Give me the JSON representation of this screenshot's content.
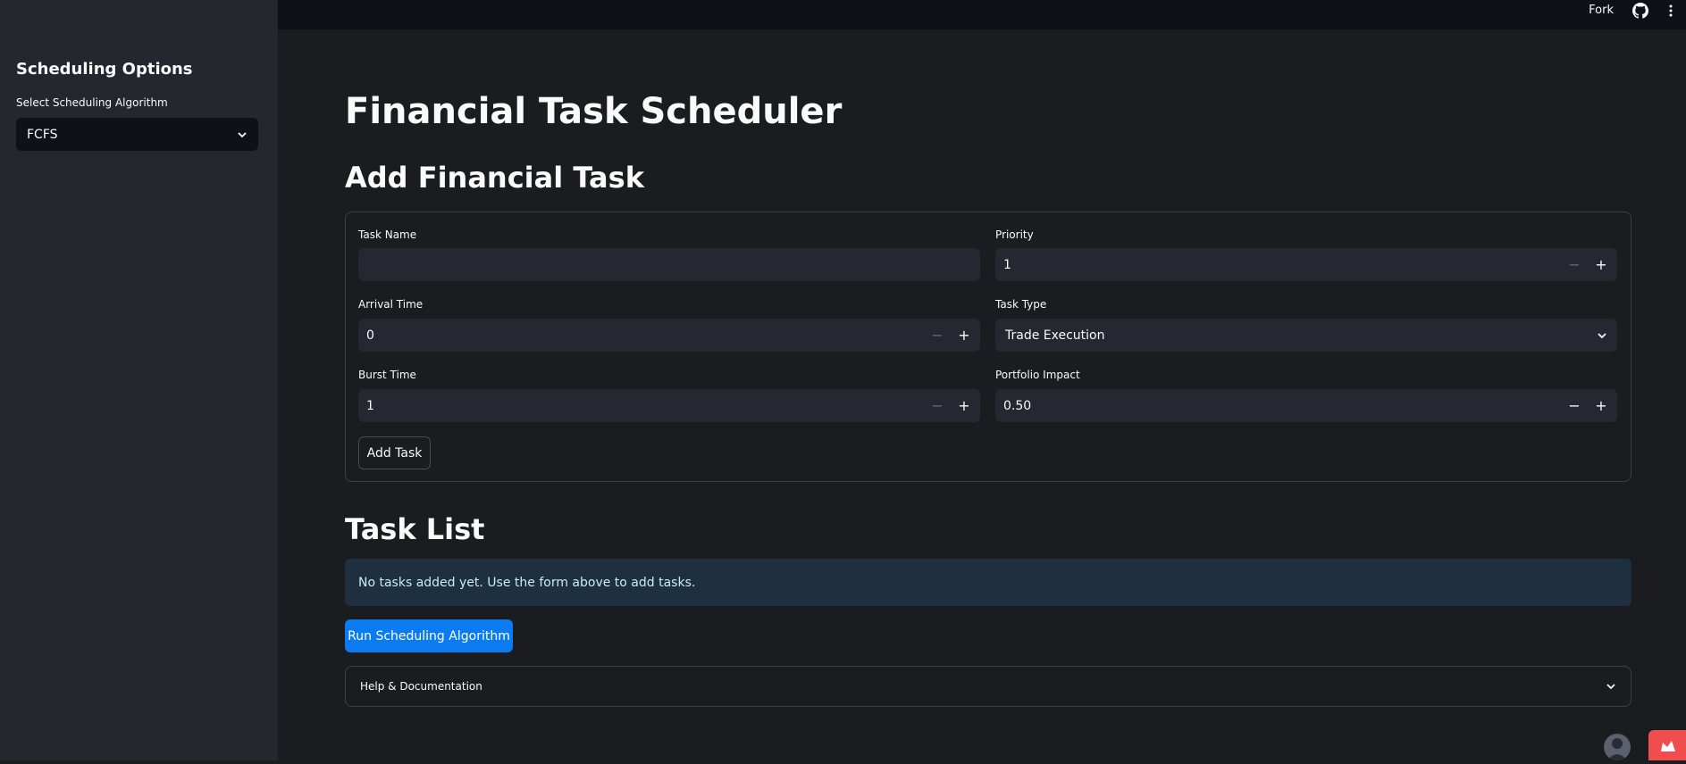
{
  "topbar": {
    "fork_label": "Fork",
    "github_icon": "github-icon",
    "menu_icon": "more-vertical-icon"
  },
  "sidebar": {
    "title": "Scheduling Options",
    "select_label": "Select Scheduling Algorithm",
    "select_value": "FCFS"
  },
  "main": {
    "title": "Financial Task Scheduler",
    "add_section_title": "Add Financial Task",
    "form": {
      "task_name": {
        "label": "Task Name",
        "value": ""
      },
      "priority": {
        "label": "Priority",
        "value": "1"
      },
      "arrival_time": {
        "label": "Arrival Time",
        "value": "0"
      },
      "task_type": {
        "label": "Task Type",
        "value": "Trade Execution"
      },
      "burst_time": {
        "label": "Burst Time",
        "value": "1"
      },
      "portfolio_impact": {
        "label": "Portfolio Impact",
        "value": "0.50"
      },
      "stepper_minus": "−",
      "stepper_plus": "+",
      "add_button": "Add Task"
    },
    "task_list_title": "Task List",
    "info_message": "No tasks added yet. Use the form above to add tasks.",
    "run_button": "Run Scheduling Algorithm",
    "help_expander": "Help & Documentation"
  },
  "colors": {
    "background": "#1b1c20",
    "sidebar": "#25262e",
    "primary_button": "#0b7bf2",
    "info_background": "#1e2f40"
  }
}
